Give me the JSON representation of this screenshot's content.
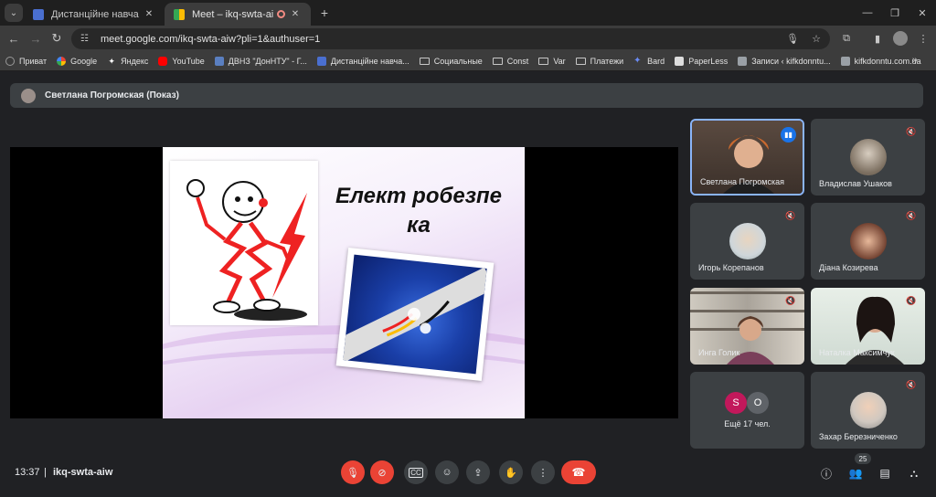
{
  "browser": {
    "tabs": [
      {
        "title": "Дистанційне навчання в ВСП",
        "active": false,
        "favicon_color": "#4a6fd0"
      },
      {
        "title": "Meet – ikq-swta-aiw",
        "active": true,
        "favicon_color": "#34a853"
      }
    ],
    "url": "meet.google.com/ikq-swta-aiw?pli=1&authuser=1",
    "bookmarks": [
      {
        "label": "Приват",
        "icon": "privat-icon",
        "color": "#3a3a3a"
      },
      {
        "label": "Google",
        "icon": "google-icon",
        "color": "#ffffff"
      },
      {
        "label": "Яндекс",
        "icon": "yandex-icon",
        "color": "#222222"
      },
      {
        "label": "YouTube",
        "icon": "youtube-icon",
        "color": "#ff0000"
      },
      {
        "label": "ДВНЗ \"ДонНТУ\" - Г...",
        "icon": "donntu-icon",
        "color": "#5a7fc0"
      },
      {
        "label": "Дистанційне навча...",
        "icon": "classroom-icon",
        "color": "#4a6fd0"
      },
      {
        "label": "Социальные",
        "icon": "folder-icon",
        "color": ""
      },
      {
        "label": "Const",
        "icon": "folder-icon",
        "color": ""
      },
      {
        "label": "Var",
        "icon": "folder-icon",
        "color": ""
      },
      {
        "label": "Платежи",
        "icon": "folder-icon",
        "color": ""
      },
      {
        "label": "Bard",
        "icon": "bard-icon",
        "color": "#6b8cf5"
      },
      {
        "label": "PaperLess",
        "icon": "paperless-icon",
        "color": "#dddddd"
      },
      {
        "label": "Записи ‹ kifkdonntu...",
        "icon": "wordpress-icon",
        "color": "#9aa0a6"
      },
      {
        "label": "kifkdonntu.com.ua",
        "icon": "site-icon",
        "color": "#9aa0a6"
      }
    ]
  },
  "meet": {
    "presenter_label": "Светлана Погромская (Показ)",
    "slide_title": "Елект робезпе ка",
    "participants": [
      {
        "name": "Светлана Погромская",
        "speaking": true,
        "muted": false
      },
      {
        "name": "Владислав Ушаков",
        "muted": true
      },
      {
        "name": "Игорь Корепанов",
        "muted": true
      },
      {
        "name": "Діана Козирева",
        "muted": true
      },
      {
        "name": "Инга Голик",
        "muted": true
      },
      {
        "name": "Наталка Максимчук",
        "muted": true
      },
      {
        "name": "Захар Березниченко",
        "muted": true
      }
    ],
    "others": {
      "label": "Ещё 17 чел.",
      "initials": [
        "S",
        "O"
      ],
      "colors": [
        "#c2185b",
        "#5f6368"
      ]
    },
    "time": "13:37",
    "separator": "|",
    "meeting_code": "ikq-swta-aiw",
    "participant_count": "25",
    "accent": "#8ab4f8",
    "danger": "#ea4335"
  }
}
